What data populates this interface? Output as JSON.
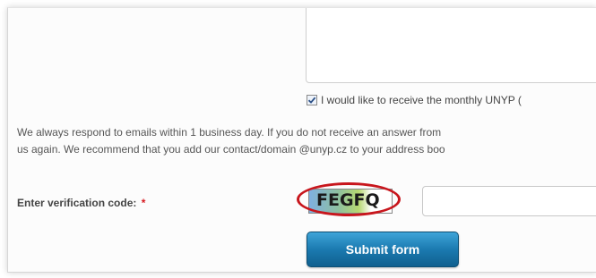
{
  "form": {
    "message_textarea": {
      "value": ""
    },
    "newsletter_checkbox": {
      "checked": true,
      "label": "I would like to receive the monthly UNYP ("
    },
    "notice_lines": [
      "We always respond to emails within 1 business day. If you do not receive an answer from",
      "us again. We recommend that you add our contact/domain @unyp.cz to your address boo"
    ],
    "verification": {
      "label": "Enter verification code:",
      "required_mark": "*",
      "captcha_text": "FEGFQ",
      "input_value": ""
    },
    "submit_label": "Submit form"
  },
  "colors": {
    "highlight": "#c8161d",
    "button": "#1b7ab0",
    "required": "#d71920"
  }
}
